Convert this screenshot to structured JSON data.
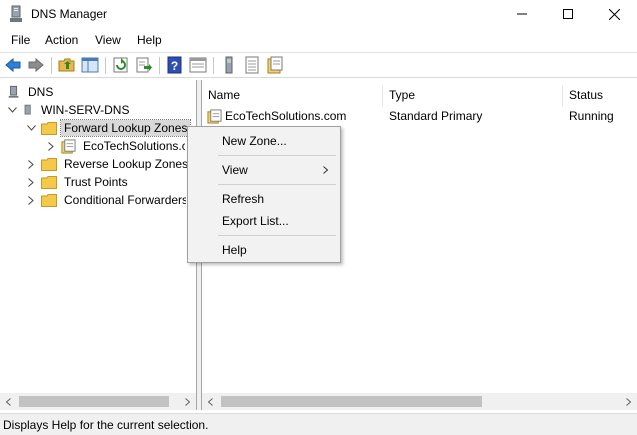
{
  "window": {
    "title": "DNS Manager",
    "icon": "dns-server-icon",
    "controls": [
      "minimize-icon",
      "maximize-icon",
      "close-icon"
    ]
  },
  "menubar": {
    "items": [
      {
        "label": "File"
      },
      {
        "label": "Action"
      },
      {
        "label": "View"
      },
      {
        "label": "Help"
      }
    ]
  },
  "toolbar": {
    "buttons": [
      "back-arrow-icon",
      "forward-arrow-icon",
      "up-folder-icon",
      "show-hide-console-tree-icon",
      "refresh-icon",
      "export-list-icon",
      "help-icon",
      "properties-pane-icon",
      "server-icon",
      "list-icon",
      "zone-icon"
    ]
  },
  "tree": {
    "root": "DNS",
    "server": "WIN-SERV-DNS",
    "items": [
      {
        "label": "Forward Lookup Zones",
        "expanded": true,
        "selected": true
      },
      {
        "label": "EcoTechSolutions.com",
        "type": "zone"
      },
      {
        "label": "Reverse Lookup Zones"
      },
      {
        "label": "Trust Points"
      },
      {
        "label": "Conditional Forwarders"
      }
    ]
  },
  "list": {
    "columns": [
      "Name",
      "Type",
      "Status"
    ],
    "rows": [
      {
        "name": "EcoTechSolutions.com",
        "type": "Standard Primary",
        "status": "Running"
      }
    ]
  },
  "context_menu": {
    "items": [
      {
        "label": "New Zone..."
      },
      {
        "label": "View",
        "submenu": true
      },
      {
        "label": "Refresh"
      },
      {
        "label": "Export List..."
      },
      {
        "label": "Help"
      }
    ]
  },
  "statusbar": {
    "text": "Displays Help for the current selection."
  },
  "colors": {
    "selection": "#d9d9d9",
    "folder": "#f3c84b",
    "menu_bg": "#f2f2f2"
  }
}
